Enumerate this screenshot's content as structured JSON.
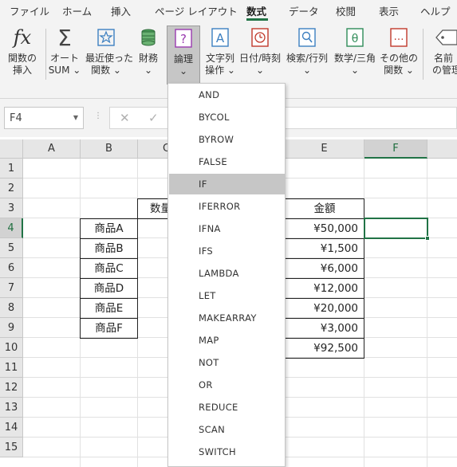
{
  "ribbon_tabs": [
    {
      "label": "ファイル",
      "active": false
    },
    {
      "label": "ホーム",
      "active": false
    },
    {
      "label": "挿入",
      "active": false
    },
    {
      "label": "ページ レイアウト",
      "active": false
    },
    {
      "label": "数式",
      "active": true
    },
    {
      "label": "データ",
      "active": false
    },
    {
      "label": "校閲",
      "active": false
    },
    {
      "label": "表示",
      "active": false
    },
    {
      "label": "ヘルプ",
      "active": false
    }
  ],
  "ribbon_buttons": [
    {
      "line1": "関数の",
      "line2": "挿入",
      "icon": "fx-icon"
    },
    {
      "line1": "オート",
      "line2": "SUM ⌄",
      "icon": "sigma-icon"
    },
    {
      "line1": "最近使った",
      "line2": "関数 ⌄",
      "icon": "star-icon"
    },
    {
      "line1": "財務",
      "line2": "⌄",
      "icon": "finance-icon"
    },
    {
      "line1": "論理",
      "line2": "⌄",
      "icon": "logic-icon"
    },
    {
      "line1": "文字列",
      "line2": "操作 ⌄",
      "icon": "text-icon"
    },
    {
      "line1": "日付/時刻",
      "line2": "⌄",
      "icon": "clock-icon"
    },
    {
      "line1": "検索/行列",
      "line2": "⌄",
      "icon": "lookup-icon"
    },
    {
      "line1": "数学/三角",
      "line2": "⌄",
      "icon": "math-icon"
    },
    {
      "line1": "その他の",
      "line2": "関数 ⌄",
      "icon": "more-functions-icon"
    },
    {
      "line1": "名前",
      "line2": "の管理",
      "icon": "name-manager-icon"
    }
  ],
  "formula_bar": {
    "name_box": "F4",
    "formula": ""
  },
  "columns": [
    "A",
    "B",
    "C",
    "D",
    "E",
    "F"
  ],
  "rows": [
    "1",
    "2",
    "3",
    "4",
    "5",
    "6",
    "7",
    "8",
    "9",
    "10",
    "11",
    "12",
    "13",
    "14",
    "15"
  ],
  "active_cell": "F4",
  "table": {
    "header_qty": "数量",
    "header_amount": "金額",
    "products": [
      "商品A",
      "商品B",
      "商品C",
      "商品D",
      "商品E",
      "商品F"
    ],
    "amounts": [
      "¥50,000",
      "¥1,500",
      "¥6,000",
      "¥12,000",
      "¥20,000",
      "¥3,000"
    ],
    "total": "¥92,500"
  },
  "dropdown": {
    "items": [
      "AND",
      "BYCOL",
      "BYROW",
      "FALSE",
      "IF",
      "IFERROR",
      "IFNA",
      "IFS",
      "LAMBDA",
      "LET",
      "MAKEARRAY",
      "MAP",
      "NOT",
      "OR",
      "REDUCE",
      "SCAN",
      "SWITCH"
    ],
    "highlighted": "IF"
  },
  "colors": {
    "accent": "#217346",
    "ribbon_bg": "#f3f3f3",
    "pressed": "#c6c6c6"
  }
}
